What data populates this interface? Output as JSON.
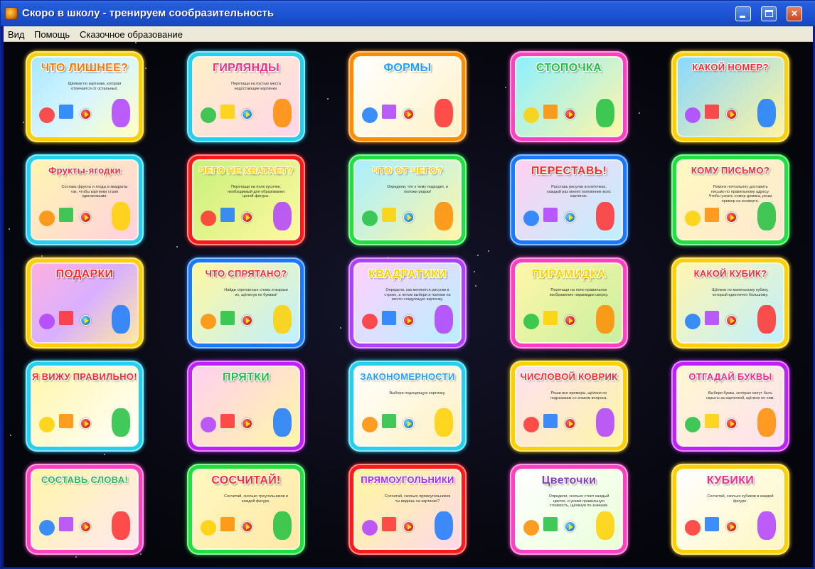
{
  "window": {
    "title": "Скоро в школу - тренируем сообразительность",
    "minimize_glyph": "_",
    "close_glyph": "✕"
  },
  "menu": [
    {
      "label": "Вид"
    },
    {
      "label": "Помощь"
    },
    {
      "label": "Сказочное образование"
    }
  ],
  "games": [
    {
      "title": "ЧТО ЛИШНЕЕ?",
      "desc": "Щёлкни по картинке, которая отличается от остальных.",
      "frame": "#ffd000",
      "bg": "linear-gradient(135deg,#a8e8ff,#d8f5ff 50%,#ffffc0)",
      "title_color": "#ff7700",
      "play": "red"
    },
    {
      "title": "ГИРЛЯНДЫ",
      "desc": "Перетащи на пустые места недостающие картинки.",
      "frame": "#24d0f0",
      "bg": "linear-gradient(135deg,#fff0c8,#ffd6e8)",
      "title_color": "#ff2a80",
      "play": "blue"
    },
    {
      "title": "ФОРМЫ",
      "desc": "",
      "frame": "#ff8c00",
      "bg": "linear-gradient(135deg,#ffffff,#fff2c8)",
      "title_color": "#1ea0ff",
      "play": "red"
    },
    {
      "title": "СТОПОЧКА",
      "desc": "",
      "frame": "#ff40c0",
      "bg": "linear-gradient(135deg,#8ef0ff,#fff6a8)",
      "title_color": "#20c040",
      "play": "red"
    },
    {
      "title": "КАКОЙ НОМЕР?",
      "desc": "",
      "frame": "#ffd000",
      "bg": "linear-gradient(135deg,#8ad8ff,#fff4a0)",
      "title_color": "#ff2a2a",
      "play": "red"
    },
    {
      "title": "Фрукты-ягодки",
      "desc": "Составь фрукты и ягоды в квадраты так, чтобы картинки стали одинаковыми.",
      "frame": "#24d0f0",
      "bg": "linear-gradient(135deg,#fff6b0,#ffd0e0)",
      "title_color": "#ff2a2a",
      "play": "red"
    },
    {
      "title": "ЧЕГО НЕ ХВАТАЕТ?",
      "desc": "Перетащи на поле кусочек, необходимый для образования целой фигуры.",
      "frame": "#ff1a1a",
      "bg": "linear-gradient(135deg,#c8f07a,#fff8a0)",
      "title_color": "#ffd000",
      "play": "red"
    },
    {
      "title": "ЧТО ОТ ЧЕГО?",
      "desc": "Определи, что к чему подходит, и положи рядом!",
      "frame": "#20e040",
      "bg": "linear-gradient(135deg,#a8f0ff,#fff6a8)",
      "title_color": "#ffd000",
      "play": "blue"
    },
    {
      "title": "ПЕРЕСТАВЬ!",
      "desc": "Расставь рисунки в клеточках, каждый раз меняя положение всех картинок.",
      "frame": "#1a7aff",
      "bg": "linear-gradient(135deg,#ffd0f0,#c0f0ff)",
      "title_color": "#ff2a2a",
      "play": "blue"
    },
    {
      "title": "КОМУ ПИСЬМО?",
      "desc": "Помоги почтальону доставить письмо по правильному адресу. Чтобы узнать номер домика, реши пример на конверте.",
      "frame": "#20e040",
      "bg": "linear-gradient(135deg,#fff8c0,#ffe8d0)",
      "title_color": "#ff2a2a",
      "play": "red"
    },
    {
      "title": "ПОДАРКИ",
      "desc": "",
      "frame": "#ffd000",
      "bg": "linear-gradient(135deg,#ffb0e0,#d8b0ff 50%,#ffe8a0)",
      "title_color": "#ff2a2a",
      "play": "blue"
    },
    {
      "title": "ЧТО СПРЯТАНО?",
      "desc": "Найди спрятанные слова и вырази их, щёлкнув по буквам!",
      "frame": "#1a7aff",
      "bg": "linear-gradient(135deg,#fff8a0,#c0f0ff)",
      "title_color": "#ff2a2a",
      "play": "red"
    },
    {
      "title": "КВАДРАТИКИ",
      "desc": "Определи, как меняются рисунки в строке, а потом выбери и положи на место следующую картинку.",
      "frame": "#b040ff",
      "bg": "linear-gradient(135deg,#ffd0ff,#b8f0ff)",
      "title_color": "#ffd000",
      "play": "red"
    },
    {
      "title": "ПИРАМИДКА",
      "desc": "Перетащи на поле правильное изображение пирамидки сверху.",
      "frame": "#ff40c0",
      "bg": "linear-gradient(135deg,#fff6a8,#c8f0a0)",
      "title_color": "#ffd000",
      "play": "red"
    },
    {
      "title": "КАКОЙ КУБИК?",
      "desc": "Щёлкни по маленькому кубику, который идентичен большому.",
      "frame": "#ffd000",
      "bg": "linear-gradient(135deg,#fff6b0,#c0f0ff)",
      "title_color": "#ff2a2a",
      "play": "red"
    },
    {
      "title": "Я ВИЖУ ПРАВИЛЬНО!",
      "desc": "",
      "frame": "#24d0f0",
      "bg": "linear-gradient(135deg,#fff6a8,#ffffff)",
      "title_color": "#ff2a2a",
      "play": "red"
    },
    {
      "title": "ПРЯТКИ",
      "desc": "",
      "frame": "#c020ff",
      "bg": "linear-gradient(135deg,#ffd0f0,#fff6a8)",
      "title_color": "#20c040",
      "play": "red"
    },
    {
      "title": "ЗАКОНОМЕРНОСТИ",
      "desc": "Выбери подходящую картинку.",
      "frame": "#24d0f0",
      "bg": "linear-gradient(135deg,#ffffff,#fff0c0)",
      "title_color": "#20a0ff",
      "play": "blue"
    },
    {
      "title": "ЧИСЛОВОЙ КОВРИК",
      "desc": "Реши все примеры, щёлкни по подсказкам со знаком вопроса.",
      "frame": "#ffd000",
      "bg": "linear-gradient(135deg,#ffe0f0,#fff6a8)",
      "title_color": "#ff2a2a",
      "play": "red"
    },
    {
      "title": "ОТГАДАЙ БУКВЫ",
      "desc": "Выбери буквы, которые могут быть скрыты за картинкой, щёлкни по ним.",
      "frame": "#c020ff",
      "bg": "linear-gradient(135deg,#fff8d0,#ffe0f0)",
      "title_color": "#ff2a80",
      "play": "red"
    },
    {
      "title": "СОСТАВЬ СЛОВА!",
      "desc": "",
      "frame": "#ff40c0",
      "bg": "linear-gradient(135deg,#fff6a8,#ffe8f0)",
      "title_color": "#20c040",
      "play": "red"
    },
    {
      "title": "СОСЧИТАЙ!",
      "desc": "Сосчитай, сколько треугольников в каждой фигуре.",
      "frame": "#20e040",
      "bg": "linear-gradient(135deg,#fff8c0,#ffe8a8)",
      "title_color": "#ff2a2a",
      "play": "red"
    },
    {
      "title": "ПРЯМОУГОЛЬНИКИ",
      "desc": "Сосчитай, сколько прямоугольников ты видишь на картинке?",
      "frame": "#ff1a1a",
      "bg": "linear-gradient(135deg,#fff8a0,#ffd8e8)",
      "title_color": "#b020ff",
      "play": "red"
    },
    {
      "title": "Цветочки",
      "desc": "Определи, сколько стоит каждый цветок, и укажи правильную стоимость, щёлкнув по значкам.",
      "frame": "#ff40c0",
      "bg": "linear-gradient(135deg,#ffffff,#e8ffd8)",
      "title_color": "#8040c0",
      "play": "blue"
    },
    {
      "title": "КУБИКИ",
      "desc": "Сосчитай, сколько кубиков в каждой фигуре.",
      "frame": "#ffd000",
      "bg": "linear-gradient(135deg,#ffffff,#fff6c0)",
      "title_color": "#ff2a80",
      "play": "red"
    }
  ]
}
